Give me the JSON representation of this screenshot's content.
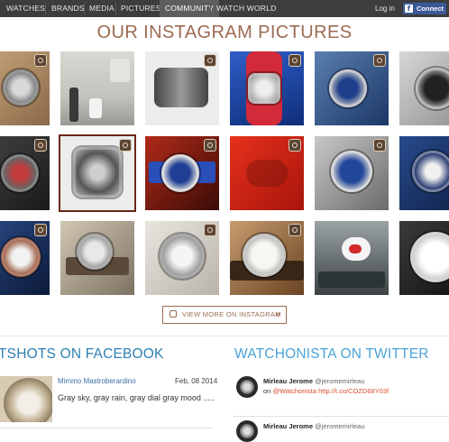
{
  "nav": {
    "items": [
      {
        "label": "WATCHES",
        "active": false
      },
      {
        "label": "BRANDS",
        "active": false
      },
      {
        "label": "MEDIA",
        "active": false
      },
      {
        "label": "PICTURES",
        "active": false
      },
      {
        "label": "COMMUNITY",
        "active": true
      },
      {
        "label": "WATCH WORLD",
        "active": false
      }
    ],
    "login_label": "Log in",
    "connect_label": "Connect"
  },
  "instagram": {
    "title": "OUR INSTAGRAM PICTURES",
    "view_more_label": "VIEW MORE ON INSTAGRAM",
    "accent_color": "#9c6b52"
  },
  "facebook": {
    "title": "TSHOTS ON FACEBOOK",
    "post": {
      "author": "Mimmo Mastroberardino",
      "date": "Feb, 08 2014",
      "text": "Gray sky, gray rain, gray dial gray mood ....."
    }
  },
  "twitter": {
    "title": "WATCHONISTA ON TWITTER",
    "tweets": [
      {
        "name": "Mirleau Jerome",
        "handle": "@jeromemirleau",
        "prefix": "on",
        "mention": "@Watchonista",
        "link": "http://t.co/COZD68Y03f"
      },
      {
        "name": "Mirleau Jerome",
        "handle": "@jeromemirleau"
      }
    ]
  },
  "colors": {
    "nav_bg": "#3d3d3d",
    "facebook_blue": "#3b5998",
    "twitter_blue": "#4aa3d6"
  }
}
